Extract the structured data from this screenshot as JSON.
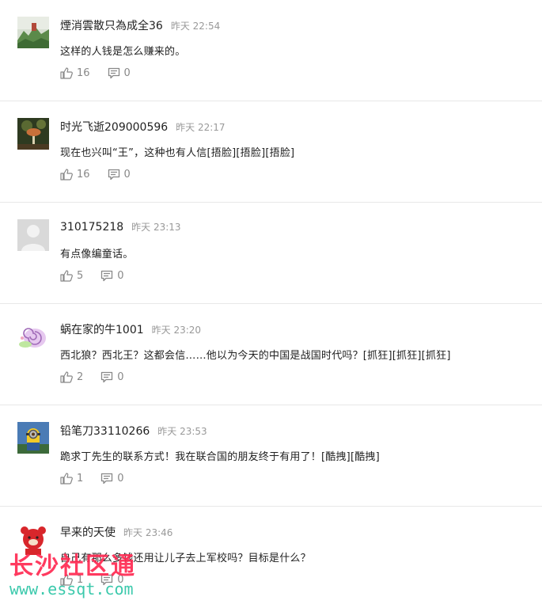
{
  "comments": [
    {
      "user": "煙消雲散只為成全36",
      "time": "昨天 22:54",
      "text": "这样的人钱是怎么赚来的。",
      "likes": "16",
      "replies": "0",
      "avatar": "landscape-avatar"
    },
    {
      "user": "时光飞逝209000596",
      "time": "昨天 22:17",
      "text": "现在也兴叫“王”，这种也有人信[捂脸][捂脸][捂脸]",
      "likes": "16",
      "replies": "0",
      "avatar": "mushroom-avatar"
    },
    {
      "user": "310175218",
      "time": "昨天 23:13",
      "text": "有点像编童话。",
      "likes": "5",
      "replies": "0",
      "avatar": "default-avatar"
    },
    {
      "user": "蜗在家的牛1001",
      "time": "昨天 23:20",
      "text": "西北狼？西北王？这都会信……他以为今天的中国是战国时代吗？[抓狂][抓狂][抓狂]",
      "likes": "2",
      "replies": "0",
      "avatar": "snail-avatar"
    },
    {
      "user": "铅笔刀33110266",
      "time": "昨天 23:53",
      "text": "跪求丁先生的联系方式！我在联合国的朋友终于有用了！[酷拽][酷拽]",
      "likes": "1",
      "replies": "0",
      "avatar": "minion-avatar"
    },
    {
      "user": "早来的天使",
      "time": "昨天 23:46",
      "text": "自己有那么多钱还用让儿子去上军校吗？目标是什么？",
      "likes": "1",
      "replies": "0",
      "avatar": "bear-avatar"
    }
  ],
  "watermark": {
    "name": "长沙社区通",
    "url": "www.essqt.com"
  }
}
